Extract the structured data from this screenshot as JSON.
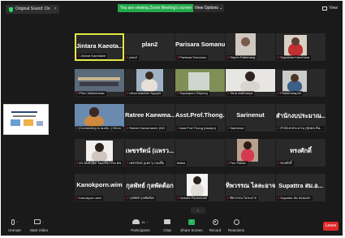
{
  "topbar": {
    "sound_label": "Original Sound: On",
    "sound_close": "×",
    "viewing_banner": "You are viewing Zoom Meeting's screen",
    "view_options": "View Options ⌄",
    "view_label": "View"
  },
  "tiles": [
    {
      "name": "Jintara Kaeota...",
      "label": "Jintara Kaeotawe"
    },
    {
      "name": "plan2",
      "label": "plan2"
    },
    {
      "name": "Parisara Somanus",
      "label": "Parisara Somanus"
    },
    {
      "name": "",
      "label": "Sripen Rattanang"
    },
    {
      "name": "",
      "label": "Supatcha Kanchona"
    },
    {
      "name": "",
      "label": "Phon Nakhonsaw"
    },
    {
      "name": "",
      "label": "Uthai watchim Nguyet"
    },
    {
      "name": "",
      "label": "Supaaporn Sirpong"
    },
    {
      "name": "",
      "label": "Tana watthanya"
    },
    {
      "name": "",
      "label": "Phakkharapon"
    },
    {
      "name": "",
      "label": "[Connecting to audio...] Khon"
    },
    {
      "name": "Ratree Kaewma...",
      "label": "Ratree Kaewmanee (NO"
    },
    {
      "name": "Asst.Prof.Thong...",
      "label": "Asst.Prof.Thong (dampo)"
    },
    {
      "name": "Sarinenut",
      "label": "Sarinenut"
    },
    {
      "name": "สำนักงบประมาณ...",
      "label": "สำนักงบประมาณ (ชุดคอ ต้น..."
    },
    {
      "name": "",
      "label": "ดร.นันท์สุนิศ วัฒนกิจกรรม BN"
    },
    {
      "name": "เพชรรัตน์ (แพรว...",
      "label": "เพชรรัตน์ (แพรว) กองทั้ม"
    },
    {
      "name": "",
      "label": "thitikit"
    },
    {
      "name": "",
      "label": "Pee Palida"
    },
    {
      "name": "ทรงศักดิ์",
      "label": "ทรงศักดิ์"
    },
    {
      "name": "Kanokporn.wim",
      "label": "Kanokporn.wim"
    },
    {
      "name": "กุลพัทธ์ กุลพัดต้อก",
      "label": "กุลพัทธ์ กุลพัดต้อก"
    },
    {
      "name": "",
      "label": "Victoria Panlormall"
    },
    {
      "name": "ทิพวรรณ ไลละอาจ",
      "label": "ทิพวรรณ ไลละอาจ"
    },
    {
      "name": "Supattra สม.อ...",
      "label": "Supattra สม.ออนแจก"
    }
  ],
  "toolbar": {
    "unmute": "Unmute",
    "start_video": "Start Video",
    "participants": "Participants",
    "participants_count": "41",
    "chat": "Chat",
    "share_screen": "Share Screen",
    "record": "Record",
    "reactions": "Reactions",
    "leave": "Leave",
    "collapse": "⌄"
  },
  "colors": {
    "accent_green": "#23a84a",
    "leave_red": "#e02828",
    "active_border": "#e2e648",
    "muted_mic": "#e43b3b"
  }
}
